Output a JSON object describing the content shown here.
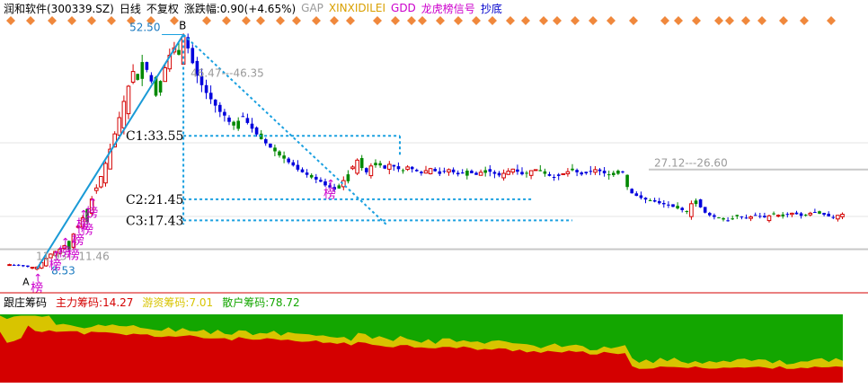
{
  "header": {
    "title": "润和软件(300339.SZ)",
    "period": "日线",
    "adjust": "不复权",
    "change_label": "涨跌幅:",
    "change_value": "0.90(+4.65%)",
    "indicators": [
      {
        "label": "GAP",
        "color": "#9a9a9a"
      },
      {
        "label": "XINXIDILEI",
        "color": "#d9a000"
      },
      {
        "label": "GDD",
        "color": "#cc00cc"
      },
      {
        "label": "龙虎榜信号",
        "color": "#cc00cc"
      },
      {
        "label": "抄底",
        "color": "#0000cc"
      }
    ]
  },
  "sub_panel": {
    "title": "跟庄筹码",
    "items": [
      {
        "label": "主力筹码:",
        "value": "14.27",
        "color": "#d40000"
      },
      {
        "label": "游资筹码:",
        "value": "7.01",
        "color": "#d8c400"
      },
      {
        "label": "散户筹码:",
        "value": "78.72",
        "color": "#13a600"
      }
    ]
  },
  "annotations": {
    "point_a": "A",
    "point_b": "B",
    "peak": "52.50",
    "low": "8.53",
    "gap_high": "46.47---46.35",
    "gap_low": "11.93---11.46",
    "gap_right": "27.12---26.60",
    "c1": "C1:33.55",
    "c2": "C2:21.45",
    "c3": "C3:17.43",
    "signal": "榜",
    "arrow": "↑"
  },
  "colors": {
    "up": "#d40000",
    "down": "#0000dd",
    "flat": "#008800",
    "trend": "#1a9ad6",
    "fib": "#1aa0e0",
    "diamond": "#f0883c",
    "signal": "#cc00cc",
    "gap_line": "#c8c8c8"
  },
  "chart_data": {
    "type": "candlestick",
    "note_units": "price in CNY",
    "seed_closes": [
      9.0,
      8.9,
      8.8,
      8.7,
      8.6,
      8.5,
      8.53,
      9.4,
      10.2,
      11.0,
      11.5,
      11.9,
      12.6,
      13.5,
      14.8,
      16.3,
      17.9,
      19.6,
      21.5,
      23.6,
      25.8,
      28.3,
      31.0,
      33.9,
      37.0,
      40.1,
      43.0,
      45.8,
      44.2,
      47.6,
      46.1,
      43.9,
      41.2,
      44.0,
      46.5,
      48.9,
      50.3,
      49.0,
      52.5,
      50.2,
      47.4,
      45.0,
      43.2,
      41.7,
      40.5,
      39.3,
      38.1,
      37.4,
      36.2,
      35.5,
      36.4,
      37.2,
      36.0,
      34.9,
      33.8,
      32.9,
      32.1,
      31.3,
      30.6,
      29.8,
      29.2,
      28.5,
      27.9,
      27.1,
      26.6,
      26.1,
      25.6,
      25.2,
      24.8,
      24.1,
      23.7,
      23.3,
      24.1,
      25.0,
      26.2,
      27.6,
      28.9,
      27.4,
      26.6,
      27.8,
      28.4,
      27.9,
      27.3,
      28.1,
      27.7,
      27.2,
      26.9,
      27.6,
      27.2,
      26.8,
      26.4,
      26.9,
      27.3,
      26.8,
      26.3,
      26.7,
      27.1,
      26.6,
      26.2,
      26.5,
      26.9,
      26.4,
      26.1,
      26.6,
      27.0,
      26.7,
      26.3,
      26.0,
      26.4,
      26.8,
      27.2,
      26.7,
      26.2,
      26.5,
      26.9,
      27.1,
      26.8,
      26.3,
      25.9,
      25.6,
      25.9,
      26.3,
      26.7,
      27.0,
      26.6,
      26.2,
      26.4,
      26.8,
      27.1,
      26.8,
      26.4,
      26.1,
      26.5,
      26.9,
      26.6,
      23.8,
      22.6,
      22.1,
      21.7,
      21.4,
      21.2,
      21.0,
      20.7,
      20.5,
      20.3,
      20.0,
      19.7,
      19.4,
      19.2,
      20.6,
      21.2,
      19.9,
      18.9,
      18.4,
      18.1,
      17.9,
      17.6,
      17.4,
      17.8,
      18.2,
      18.0,
      17.8,
      18.1,
      18.4,
      18.2,
      18.0,
      18.3,
      18.6,
      18.4,
      18.2,
      18.5,
      18.8,
      18.6,
      18.3,
      18.5,
      18.8,
      18.9,
      18.7,
      18.5,
      18.2,
      18.0,
      18.4,
      18.6
    ],
    "price_range": [
      5,
      56
    ],
    "key_levels": {
      "peak": 52.5,
      "low": 8.53,
      "c1": 33.55,
      "c2": 21.45,
      "c3": 17.43
    },
    "gaps": [
      {
        "high": 46.47,
        "low": 46.35
      },
      {
        "high": 11.93,
        "low": 11.46
      },
      {
        "high": 27.12,
        "low": 26.6
      }
    ],
    "chip_distribution": {
      "series": [
        {
          "name": "主力筹码",
          "latest": 14.27
        },
        {
          "name": "游资筹码",
          "latest": 7.01
        },
        {
          "name": "散户筹码",
          "latest": 78.72
        }
      ]
    }
  }
}
